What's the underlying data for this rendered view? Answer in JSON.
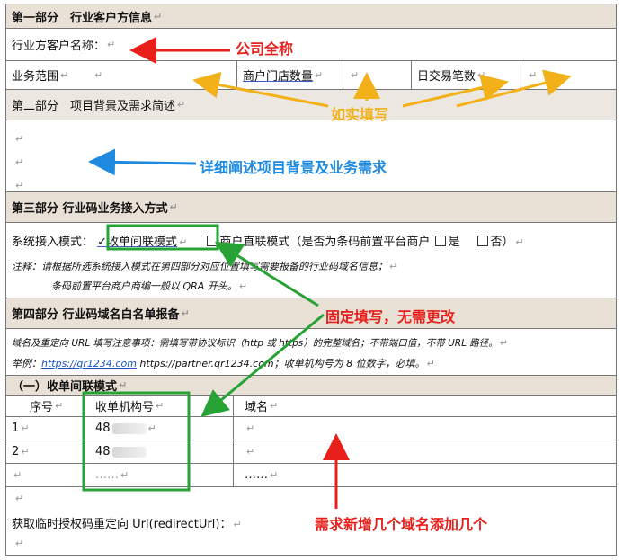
{
  "part1": {
    "title": "第一部分　行业客户方信息",
    "client_name_label": "行业方客户名称：",
    "business_scope_label": "业务范围",
    "store_count_label": "商户门店数量",
    "daily_tx_label": "日交易笔数"
  },
  "part2": {
    "title": "第二部分　项目背景及需求简述"
  },
  "part3": {
    "title": "第三部分  行业码业务接入方式",
    "access_mode_label": "系统接入模式：",
    "option_acquirer": "✓收单间联模式",
    "option_direct": "商户直联模式（是否为条码前置平台商户",
    "yes": "是",
    "no": "否）",
    "note1": "注释：请根据所选系统接入模式在第四部分对应位置填写需要报备的行业码域名信息；",
    "note2": "条码前置平台商户商编一般以 QRA 开头。"
  },
  "part4": {
    "title": "第四部分  行业码域名白名单报备",
    "note1": "域名及重定向 URL 填写注意事项：需填写带协议标识（http 或 https）的完整域名；不带端口值，不带 URL 路径。",
    "example_label": "举例：",
    "example_link": "https://qr1234.com",
    "example_rest": "  https://partner.qr1234.com；收单机构号为 8 位数字，必填。",
    "subtitle": "（一）收单间联模式",
    "col_seq": "序号",
    "col_org": "收单机构号",
    "col_domain": "域名",
    "rows": [
      {
        "seq": "1",
        "org": "48",
        "domain": ""
      },
      {
        "seq": "2",
        "org": "48",
        "domain": ""
      },
      {
        "seq": "",
        "org": "……",
        "domain": "……"
      }
    ],
    "redirect_label": "获取临时授权码重定向 Url(redirectUrl)：",
    "redirect_underlined": "Url(redirectUrl)"
  },
  "annotations": {
    "company_full_name": "公司全称",
    "fill_truthfully": "如实填写",
    "describe_background": "详细阐述项目背景及业务需求",
    "fixed_fill": "固定填写，无需更改",
    "add_domains": "需求新增几个域名添加几个"
  },
  "colors": {
    "red": "#e8201c",
    "yellow": "#f2b118",
    "blue": "#1f8ae0",
    "green": "#27a336",
    "header_bg": "#e9e0d6"
  }
}
